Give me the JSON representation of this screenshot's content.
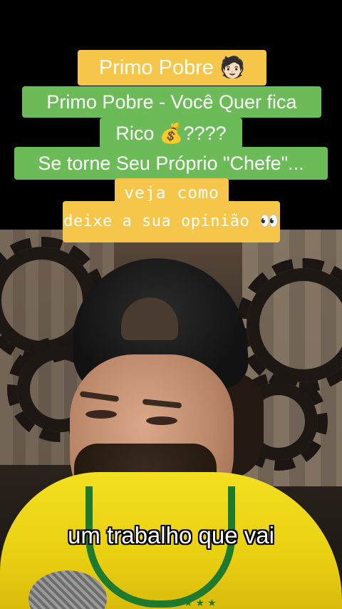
{
  "overlay": {
    "title_line": "Primo Pobre 🧑🏻",
    "line_2": "Primo Pobre - Você Quer fica",
    "line_3": "Rico 💰????",
    "line_4": "Se torne Seu Próprio \"Chefe\"...",
    "line_5": "veja como",
    "line_6": "deixe a sua opinião 👀"
  },
  "video": {
    "subtitle": "um trabalho que vai"
  },
  "colors": {
    "gold_label": "#f5c64a",
    "green_label": "#6cbb58"
  }
}
